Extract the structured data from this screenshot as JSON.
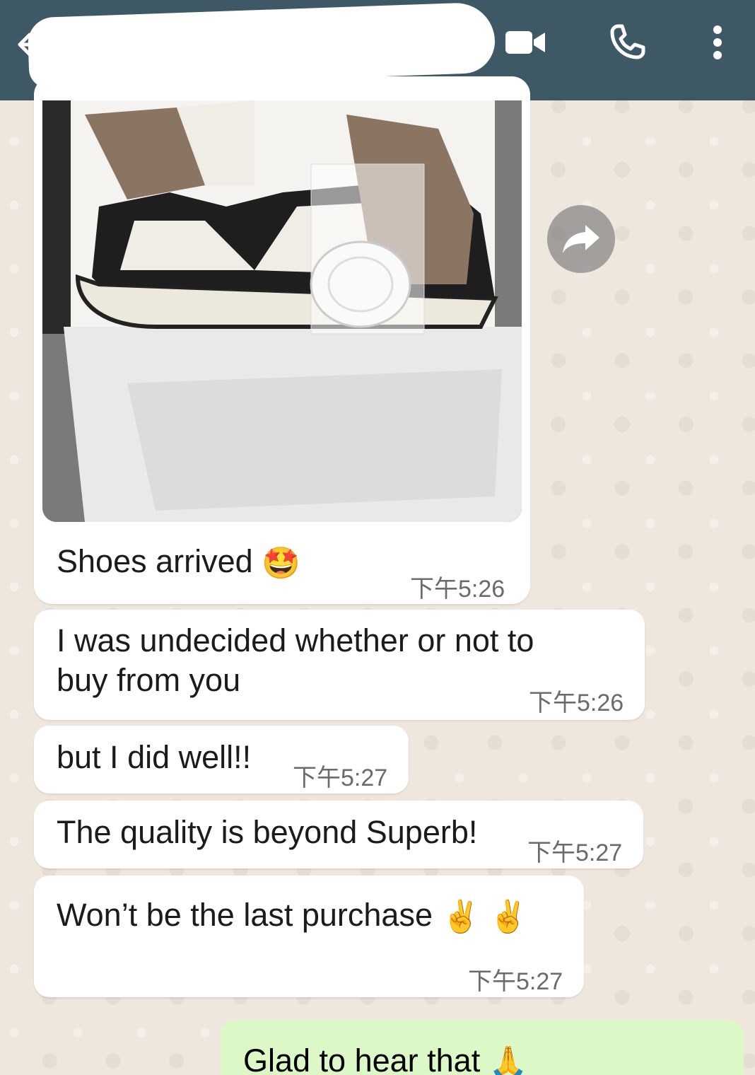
{
  "header": {
    "contact_name": "•••••••••• ••••••• ••••",
    "icons": [
      "back-arrow-icon",
      "video-call-icon",
      "voice-call-icon",
      "more-options-icon"
    ]
  },
  "messages": [
    {
      "text": "Shoes arrived",
      "emoji": "🤩",
      "time": "下午5:26",
      "has_image": true
    },
    {
      "text": "I was undecided whether or not to buy from you",
      "time": "下午5:26"
    },
    {
      "text": "but I did well!!",
      "time": "下午5:27"
    },
    {
      "text": "The quality is beyond Superb!",
      "time": "下午5:27"
    },
    {
      "text": "Won’t be the last purchase",
      "emoji": "✌️ ✌️",
      "time": "下午5:27"
    }
  ],
  "outgoing": {
    "text": "Glad to hear that",
    "emoji": "🙏"
  },
  "colors": {
    "header": "#3f5866",
    "chat_background": "#efe7de",
    "incoming_bubble": "#ffffff",
    "outgoing_bubble": "#dcf8c6",
    "timestamp": "#6b6b6b"
  }
}
